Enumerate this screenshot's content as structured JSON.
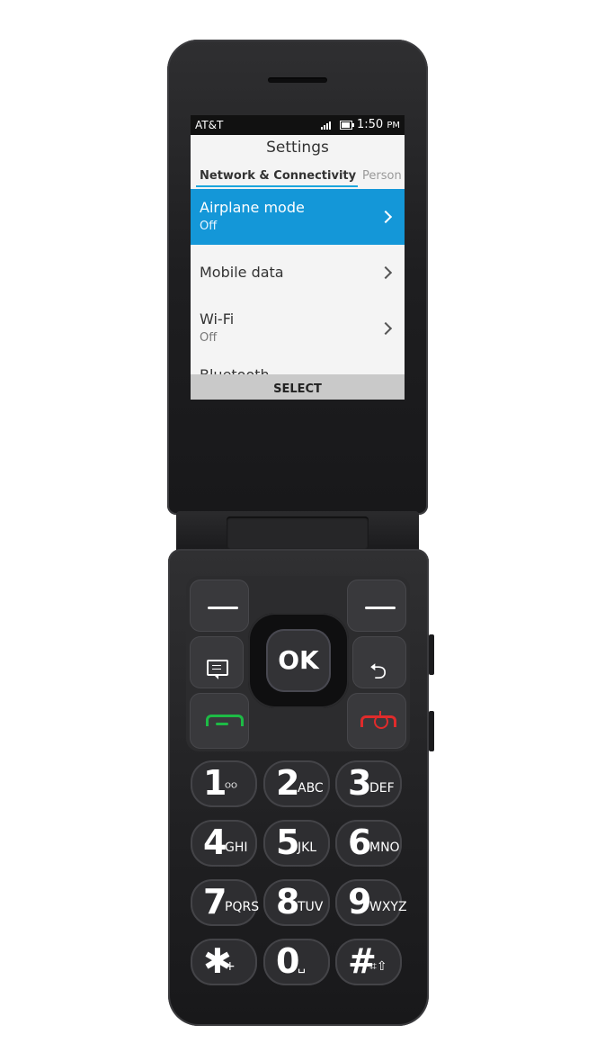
{
  "status_bar": {
    "carrier": "AT&T",
    "time": "1:50",
    "meridiem": "PM"
  },
  "screen": {
    "title": "Settings",
    "tabs": {
      "active": "Network & Connectivity",
      "next": "Person"
    },
    "items": [
      {
        "title": "Airplane mode",
        "subtitle": "Off",
        "selected": true
      },
      {
        "title": "Mobile data",
        "subtitle": "",
        "selected": false
      },
      {
        "title": "Wi-Fi",
        "subtitle": "Off",
        "selected": false
      },
      {
        "title": "Bluetooth",
        "subtitle": "",
        "selected": false
      }
    ],
    "softkey_center": "SELECT"
  },
  "keypad": {
    "ok_label": "OK",
    "keys": [
      {
        "main": "1",
        "sub": "ᴼᴼ"
      },
      {
        "main": "2",
        "sub": "ABC"
      },
      {
        "main": "3",
        "sub": "DEF"
      },
      {
        "main": "4",
        "sub": "GHI"
      },
      {
        "main": "5",
        "sub": "JKL"
      },
      {
        "main": "6",
        "sub": "MNO"
      },
      {
        "main": "7",
        "sub": "PQRS"
      },
      {
        "main": "8",
        "sub": "TUV"
      },
      {
        "main": "9",
        "sub": "WXYZ"
      },
      {
        "main": "✱",
        "sub": "+"
      },
      {
        "main": "0",
        "sub": "␣"
      },
      {
        "main": "#",
        "sub": "⌗⇧"
      }
    ]
  },
  "colors": {
    "highlight": "#1497d8",
    "tab_indicator": "#1ba6dc",
    "call_green": "#1dbb45",
    "end_red": "#e02b2b"
  }
}
